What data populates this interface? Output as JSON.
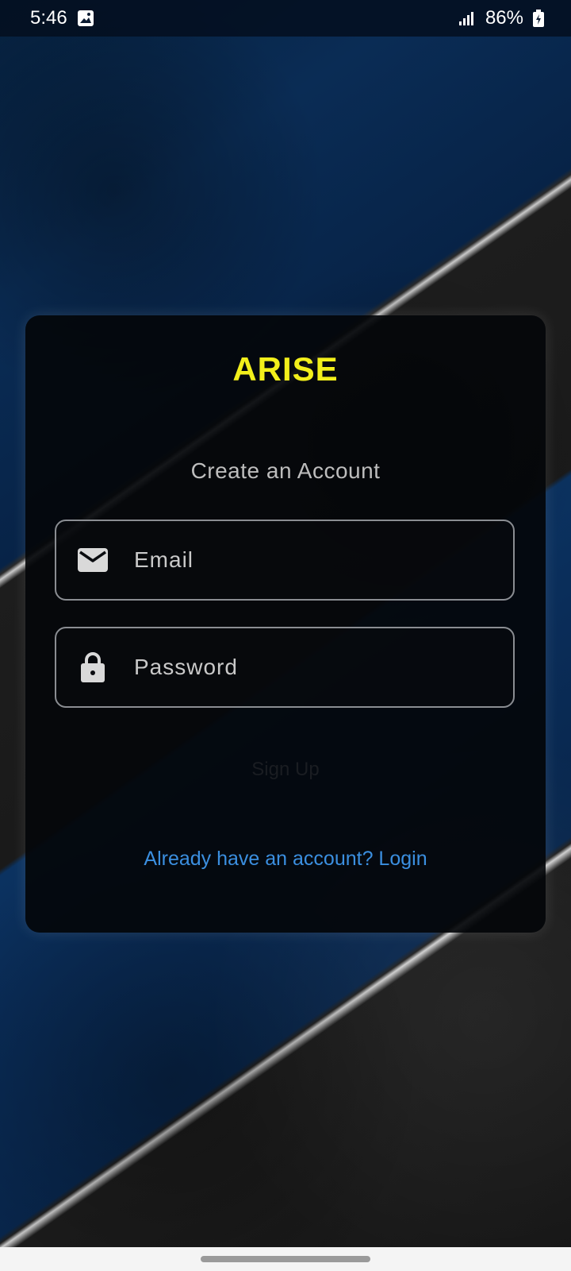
{
  "status_bar": {
    "time": "5:46",
    "battery": "86%",
    "icons": [
      "gallery-icon",
      "signal-icon",
      "battery-charging-icon"
    ]
  },
  "card": {
    "app_title": "ARISE",
    "subtitle": "Create an Account",
    "email": {
      "placeholder": "Email",
      "value": "",
      "icon": "mail-icon"
    },
    "password": {
      "placeholder": "Password",
      "value": "",
      "icon": "lock-icon"
    },
    "signup_label": "Sign Up",
    "login_link": "Already have an account? Login"
  },
  "colors": {
    "title": "#f2ef1b",
    "link": "#3b8fe0",
    "card_bg": "#04060a",
    "field_border": "#8a8d92"
  }
}
